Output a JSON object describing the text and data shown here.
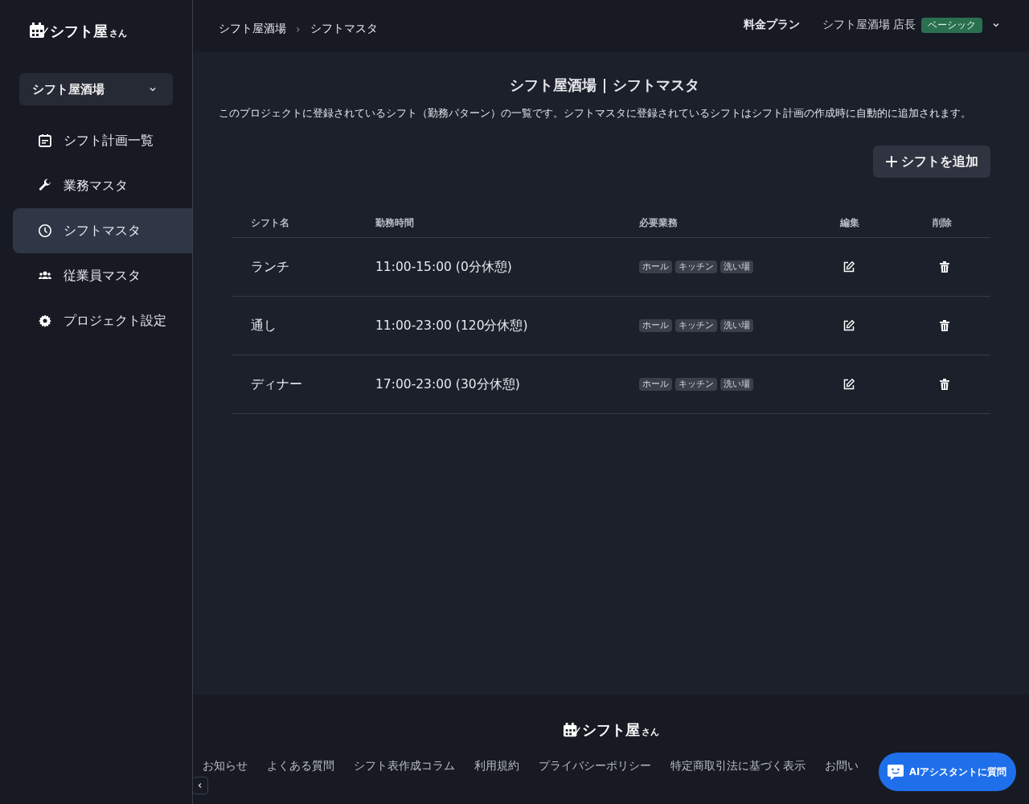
{
  "sidebar": {
    "logo": {
      "main": "シフト屋",
      "suffix": "さん"
    },
    "project": "シフト屋酒場",
    "items": [
      {
        "label": "シフト計画一覧",
        "kind": "calendar",
        "selected": false
      },
      {
        "label": "業務マスタ",
        "kind": "wrench",
        "selected": false
      },
      {
        "label": "シフトマスタ",
        "kind": "clock",
        "selected": true
      },
      {
        "label": "従業員マスタ",
        "kind": "users",
        "selected": false
      },
      {
        "label": "プロジェクト設定",
        "kind": "gear",
        "selected": false
      }
    ]
  },
  "header": {
    "breadcrumb": [
      "シフト屋酒場",
      "シフトマスタ"
    ],
    "separator": "›",
    "pricing": "料金プラン",
    "user": "シフト屋酒場 店長",
    "plan_badge": "ベーシック"
  },
  "page": {
    "title": "シフト屋酒場 | シフトマスタ",
    "description": "このプロジェクトに登録されているシフト（勤務パターン）の一覧です。シフトマスタに登録されているシフトはシフト計画の作成時に自動的に追加されます。",
    "add_button": "シフトを追加"
  },
  "table": {
    "columns": [
      "シフト名",
      "勤務時間",
      "必要業務",
      "編集",
      "削除"
    ],
    "rows": [
      {
        "name": "ランチ",
        "time": "11:00-15:00 (0分休憩)",
        "tasks": [
          "ホール",
          "キッチン",
          "洗い場"
        ]
      },
      {
        "name": "通し",
        "time": "11:00-23:00 (120分休憩)",
        "tasks": [
          "ホール",
          "キッチン",
          "洗い場"
        ]
      },
      {
        "name": "ディナー",
        "time": "17:00-23:00 (30分休憩)",
        "tasks": [
          "ホール",
          "キッチン",
          "洗い場"
        ]
      }
    ]
  },
  "footer": {
    "logo": {
      "main": "シフト屋",
      "suffix": "さん"
    },
    "links": [
      "お知らせ",
      "よくある質問",
      "シフト表作成コラム",
      "利用規約",
      "プライバシーポリシー",
      "特定商取引法に基づく表示",
      "お問い"
    ]
  },
  "assistant_button": "AIアシスタントに質問"
}
